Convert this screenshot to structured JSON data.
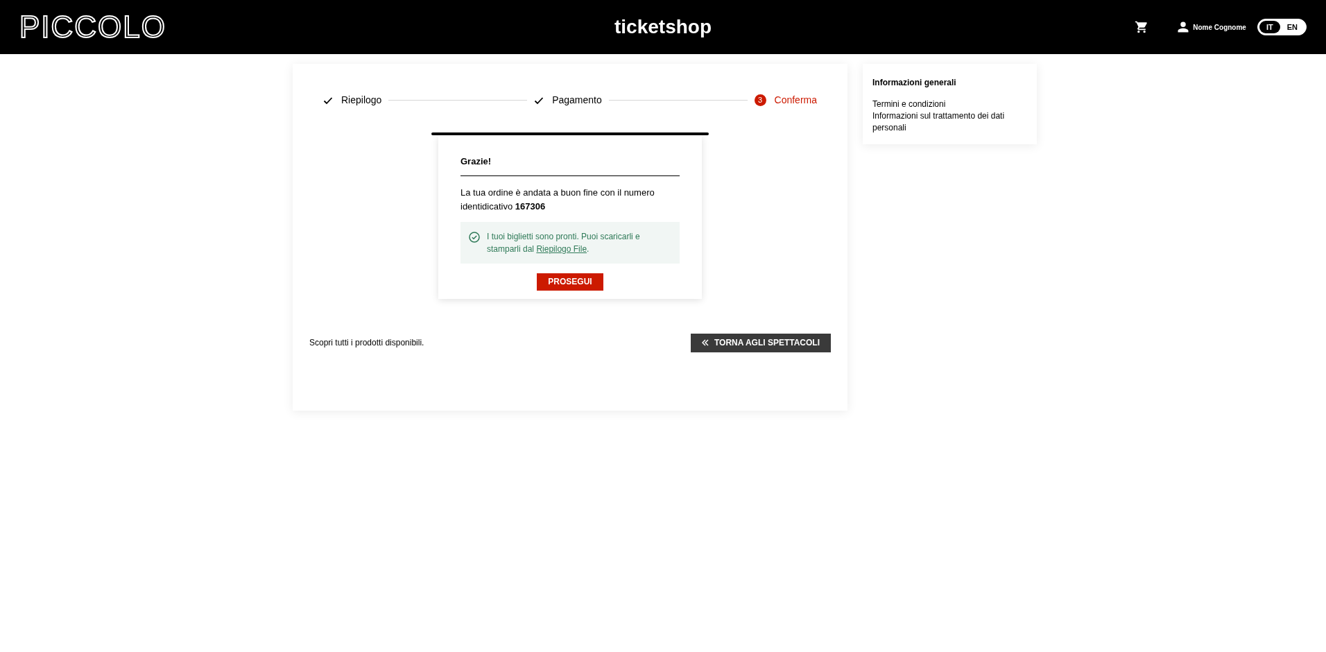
{
  "header": {
    "logo": "PICCOLO",
    "title": "ticketshop",
    "user": "Nome Cognome",
    "languages": [
      {
        "label": "IT",
        "selected": true
      },
      {
        "label": "EN",
        "selected": false
      }
    ]
  },
  "steps": [
    {
      "label": "Riepilogo",
      "kind": "done"
    },
    {
      "label": "Pagamento",
      "kind": "done"
    },
    {
      "label": "Conferma",
      "kind": "current",
      "number": "3"
    }
  ],
  "confirmation": {
    "title": "Grazie!",
    "message": "La tua ordine è andata a buon fine con il numero identidicativo **167306**",
    "notice": "I tuoi biglietti sono pronti. Puoi scaricarli e stamparli dal ",
    "notice_link": "Riepilogo File",
    "notice_end": ".",
    "button": "PROSEGUI"
  },
  "footer": {
    "text": "Scopri tutti i prodotti disponibili.",
    "button": "TORNA AGLI SPETTACOLI"
  },
  "sidebar": {
    "title": "Informazioni generali",
    "links": [
      "Termini e condizioni",
      "Informazioni sul trattamento dei dati personali"
    ]
  }
}
